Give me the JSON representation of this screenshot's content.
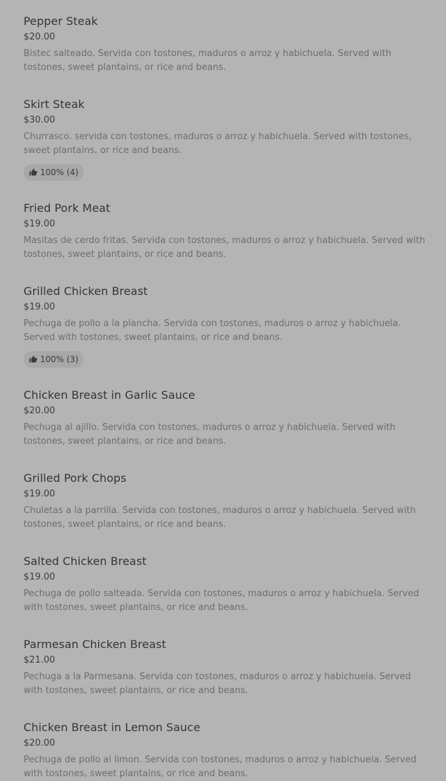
{
  "menu": {
    "items": [
      {
        "name": "Pepper Steak",
        "price": "$20.00",
        "description": "Bistec salteado. Servida con tostones, maduros o arroz y habichuela. Served with tostones, sweet plantains, or rice and beans.",
        "rating": ""
      },
      {
        "name": "Skirt Steak",
        "price": "$30.00",
        "description": "Churrasco. servida con tostones, maduros o arroz y habichuela. Served with tostones, sweet plantains, or rice and beans.",
        "rating": "100% (4)"
      },
      {
        "name": "Fried Pork Meat",
        "price": "$19.00",
        "description": "Masitas de cerdo fritas. Servida con tostones, maduros o arroz y habichuela. Served with tostones, sweet plantains, or rice and beans.",
        "rating": ""
      },
      {
        "name": "Grilled Chicken Breast",
        "price": "$19.00",
        "description": "Pechuga de pollo a la plancha. Servida con tostones, maduros o arroz y habichuela. Served with tostones, sweet plantains, or rice and beans.",
        "rating": "100% (3)"
      },
      {
        "name": "Chicken Breast in Garlic Sauce",
        "price": "$20.00",
        "description": "Pechuga al ajillo. Servida con tostones, maduros o arroz y habichuela. Served with tostones, sweet plantains, or rice and beans.",
        "rating": ""
      },
      {
        "name": "Grilled Pork Chops",
        "price": "$19.00",
        "description": "Chuletas a la parrilla. Servida con tostones, maduros o arroz y habichuela. Served with tostones, sweet plantains, or rice and beans.",
        "rating": ""
      },
      {
        "name": "Salted Chicken Breast",
        "price": "$19.00",
        "description": "Pechuga de pollo salteada. Servida con tostones, maduros o arroz y habichuela. Served with tostones, sweet plantains, or rice and beans.",
        "rating": ""
      },
      {
        "name": "Parmesan Chicken Breast",
        "price": "$21.00",
        "description": "Pechuga a la Parmesana. Servida con tostones, maduros o arroz y habichuela. Served with tostones, sweet plantains, or rice and beans.",
        "rating": ""
      },
      {
        "name": "Chicken Breast in Lemon Sauce",
        "price": "$20.00",
        "description": "Pechuga de pollo al limon. Servida con tostones, maduros o arroz y habichuela. Served with tostones, sweet plantains, or rice and beans.",
        "rating": ""
      }
    ]
  },
  "icons": {
    "rating": "thumbs-up-icon"
  }
}
